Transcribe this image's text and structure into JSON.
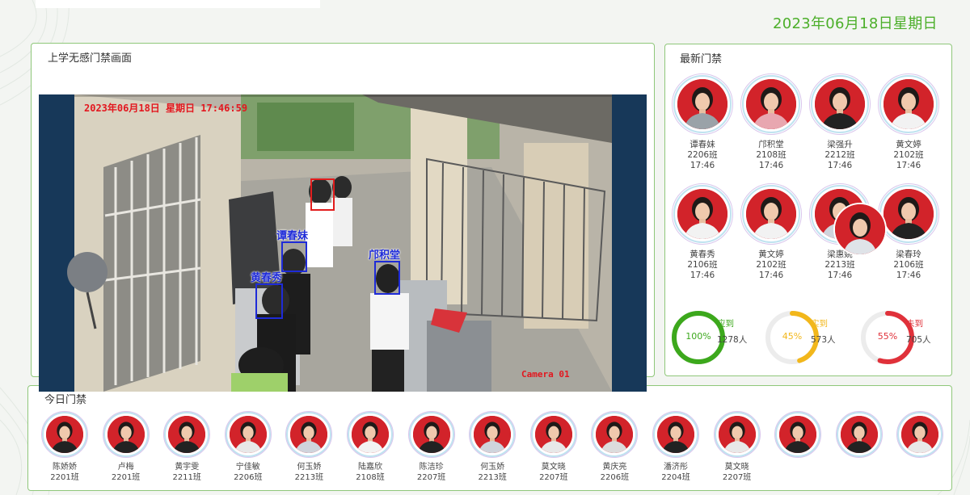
{
  "header": {
    "date": "2023年06月18日星期日"
  },
  "camera": {
    "title": "上学无感门禁画面",
    "osd_datetime": "2023年06月18日  星期日  17:46:59",
    "osd_camera": "Camera 01",
    "detections": [
      {
        "label": "谭春妹"
      },
      {
        "label": "邝积堂"
      },
      {
        "label": "黄春秀"
      },
      {
        "label": ""
      }
    ]
  },
  "latest": {
    "title": "最新门禁",
    "people": [
      {
        "name": "谭春妹",
        "class": "2206班",
        "time": "17:46",
        "shirt": "#9aa2a8"
      },
      {
        "name": "邝积堂",
        "class": "2108班",
        "time": "17:46",
        "shirt": "#e8a7b0"
      },
      {
        "name": "梁强升",
        "class": "2212班",
        "time": "17:46",
        "shirt": "#222222"
      },
      {
        "name": "黄文婷",
        "class": "2102班",
        "time": "17:46",
        "shirt": "#f2f2f2"
      },
      {
        "name": "黄春秀",
        "class": "2106班",
        "time": "17:46",
        "shirt": "#f2f2f2"
      },
      {
        "name": "黄文婷",
        "class": "2102班",
        "time": "17:46",
        "shirt": "#f2f2f2"
      },
      {
        "name": "梁惠姚",
        "class": "2213班",
        "time": "17:46",
        "shirt": "#cfd4dc"
      },
      {
        "name": "梁春玲",
        "class": "2106班",
        "time": "17:46",
        "shirt": "#222222"
      }
    ]
  },
  "stats": [
    {
      "percent": "100%",
      "fraction": 1.0,
      "label": "应到",
      "count": "1278人",
      "color": "#3ca81c"
    },
    {
      "percent": "45%",
      "fraction": 0.45,
      "label": "实到",
      "count": "573人",
      "color": "#f2b71b"
    },
    {
      "percent": "55%",
      "fraction": 0.55,
      "label": "未到",
      "count": "705人",
      "color": "#e0313a"
    }
  ],
  "today": {
    "title": "今日门禁",
    "people": [
      {
        "name": "陈娇娇",
        "class": "2201班",
        "shirt": "#222222"
      },
      {
        "name": "卢梅",
        "class": "2201班",
        "shirt": "#222222"
      },
      {
        "name": "黄宇雯",
        "class": "2211班",
        "shirt": "#222222"
      },
      {
        "name": "宁佳敏",
        "class": "2206班",
        "shirt": "#e8e8e8"
      },
      {
        "name": "何玉娇",
        "class": "2213班",
        "shirt": "#cfd4dc"
      },
      {
        "name": "陆嘉欣",
        "class": "2108班",
        "shirt": "#f2f2f2"
      },
      {
        "name": "陈洁珍",
        "class": "2207班",
        "shirt": "#222222"
      },
      {
        "name": "何玉娇",
        "class": "2213班",
        "shirt": "#cfd4dc"
      },
      {
        "name": "莫文晓",
        "class": "2207班",
        "shirt": "#e8e8e8"
      },
      {
        "name": "黄庆亮",
        "class": "2206班",
        "shirt": "#dcdcdc"
      },
      {
        "name": "潘济彤",
        "class": "2204班",
        "shirt": "#222222"
      },
      {
        "name": "莫文晓",
        "class": "2207班",
        "shirt": "#e8e8e8"
      },
      {
        "name": "",
        "class": "",
        "shirt": "#222222"
      },
      {
        "name": "",
        "class": "",
        "shirt": "#222222"
      },
      {
        "name": "",
        "class": "",
        "shirt": "#e8e8e8"
      }
    ]
  }
}
